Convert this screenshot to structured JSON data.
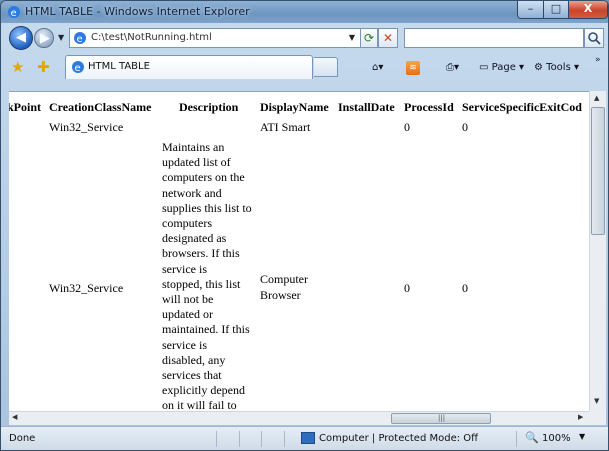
{
  "window": {
    "title": "HTML TABLE - Windows Internet Explorer",
    "controls": {
      "minimize": "–",
      "maximize": "□",
      "close": "X"
    }
  },
  "address": {
    "url": "C:\\test\\NotRunning.html"
  },
  "tab": {
    "label": "HTML TABLE"
  },
  "toolbar": {
    "page_label": "Page",
    "tools_label": "Tools"
  },
  "table": {
    "headers": [
      "kPoint",
      "CreationClassName",
      "Description",
      "DisplayName",
      "InstallDate",
      "ProcessId",
      "ServiceSpecificExitCod"
    ],
    "rows": [
      {
        "creation_class": "Win32_Service",
        "description": "",
        "display_name": "ATI Smart",
        "process_id": "0",
        "exit_code": "0"
      },
      {
        "creation_class": "Win32_Service",
        "description_lines": [
          "Maintains an",
          "updated list of",
          "computers on the",
          "network and",
          "supplies this list to",
          "computers",
          "designated as",
          "browsers. If this",
          "service is",
          "stopped, this list",
          "will not be",
          "updated or",
          "maintained. If this",
          "service is",
          "disabled, any",
          "services that",
          "explicitly depend",
          "on it will fail to"
        ],
        "display_name_line1": "Computer",
        "display_name_line2": "Browser",
        "process_id": "0",
        "exit_code": "0"
      }
    ]
  },
  "status": {
    "left": "Done",
    "zone": "Computer | Protected Mode: Off",
    "zoom": "100%"
  },
  "icons": [
    "ie-icon",
    "back-icon",
    "forward-icon",
    "refresh-icon",
    "stop-icon",
    "search-icon",
    "favorites-star-icon",
    "add-favorites-icon",
    "home-icon",
    "feeds-icon",
    "print-icon",
    "page-icon",
    "tools-icon",
    "computer-zone-icon",
    "zoom-icon"
  ]
}
